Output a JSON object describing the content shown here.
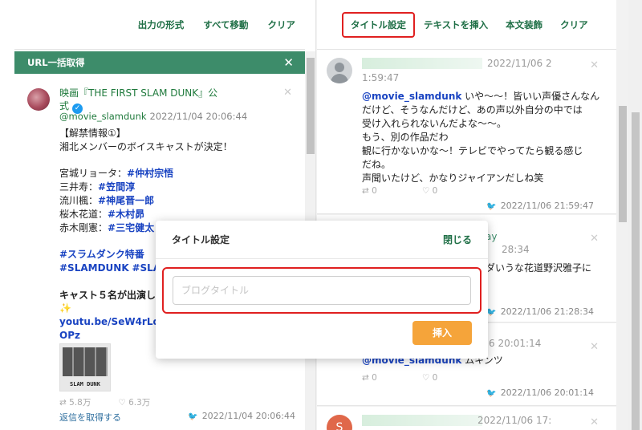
{
  "left_toolbar": {
    "buttons": [
      "出力の形式",
      "すべて移動",
      "クリア"
    ]
  },
  "right_toolbar": {
    "buttons": [
      "タイトル設定",
      "テキストを挿入",
      "本文装飾",
      "クリア"
    ]
  },
  "url_panel": {
    "title": "URL一括取得",
    "close": "✕"
  },
  "main_tweet": {
    "name_line1": "映画『THE FIRST SLAM DUNK』公",
    "name_line2": "式",
    "handle": "@movie_slamdunk",
    "timestamp": "2022/11/04 20:06:44",
    "lines": [
      {
        "parts": [
          {
            "t": "【解禁情報①】",
            "k": ""
          }
        ]
      },
      {
        "parts": [
          {
            "t": "湘北メンバーのボイスキャストが決定！",
            "k": ""
          }
        ]
      },
      {
        "parts": []
      },
      {
        "parts": [
          {
            "t": "宮城リョータ：",
            "k": ""
          },
          {
            "t": "#仲村宗悟",
            "k": "link"
          }
        ]
      },
      {
        "parts": [
          {
            "t": "三井寿：",
            "k": ""
          },
          {
            "t": "#笠間淳",
            "k": "link"
          }
        ]
      },
      {
        "parts": [
          {
            "t": "流川楓：",
            "k": ""
          },
          {
            "t": "#神尾晋一郎",
            "k": "link"
          }
        ]
      },
      {
        "parts": [
          {
            "t": "桜木花道：",
            "k": ""
          },
          {
            "t": "#木村昴",
            "k": "link"
          }
        ]
      },
      {
        "parts": [
          {
            "t": "赤木剛憲：",
            "k": ""
          },
          {
            "t": "#三宅健太",
            "k": "link"
          }
        ]
      },
      {
        "parts": []
      },
      {
        "parts": [
          {
            "t": "#スラムダンク特番",
            "k": "link"
          }
        ]
      },
      {
        "parts": [
          {
            "t": "#SLAMDUNK",
            "k": "link"
          },
          {
            "t": " ",
            "k": ""
          },
          {
            "t": "#SLAM",
            "k": "link"
          }
        ]
      },
      {
        "parts": []
      },
      {
        "parts": [
          {
            "t": "キャスト５名が出演し",
            "k": "bold"
          }
        ]
      },
      {
        "parts": [
          {
            "t": "✨",
            "k": ""
          }
        ]
      },
      {
        "parts": [
          {
            "t": "youtu.be/SeW4rLqyX",
            "k": "link"
          }
        ]
      },
      {
        "parts": [
          {
            "t": "OPz",
            "k": "link"
          }
        ]
      }
    ],
    "thumbnail_title": "SLAM DUNK",
    "retweets": "5.8万",
    "likes": "6.3万",
    "fetch_replies": "返信を取得する",
    "footer_time": "2022/11/04 20:06:44"
  },
  "timeline": {
    "card1": {
      "ts_a": "2022/11/06 2",
      "ts_b": "1:59:47",
      "lines": [
        {
          "parts": [
            {
              "t": "@movie_slamdunk",
              "k": "mention"
            },
            {
              "t": " いや〜〜！皆いい声優さんなん",
              "k": ""
            }
          ]
        },
        {
          "parts": [
            {
              "t": "だけど、そうなんだけど、あの声以外自分の中では",
              "k": ""
            }
          ]
        },
        {
          "parts": [
            {
              "t": "受け入れられないんだよな〜〜。",
              "k": ""
            }
          ]
        },
        {
          "parts": [
            {
              "t": "もう、別の作品だわ",
              "k": ""
            }
          ]
        },
        {
          "parts": [
            {
              "t": "観に行かないかな〜！テレビでやってたら観る感じ",
              "k": ""
            }
          ]
        },
        {
          "parts": [
            {
              "t": "だね。",
              "k": ""
            }
          ]
        },
        {
          "parts": [
            {
              "t": "声聞いたけど、かなりジャイアンだしね笑",
              "k": ""
            }
          ]
        }
      ],
      "retweets": "0",
      "likes": "0",
      "footer_time": "2022/11/06 21:59:47"
    },
    "card2": {
      "ts_a": "ay",
      "ts_b": "28:34",
      "lines": [
        {
          "parts": [
            {
              "t": "ダいうな花道野沢雅子に",
              "k": ""
            }
          ]
        }
      ],
      "footer_time": "2022/11/06 21:28:34"
    },
    "card3": {
      "ts_b": "6 20:01:14",
      "lines": [
        {
          "parts": [
            {
              "t": "@movie_slamdunk",
              "k": "mention"
            },
            {
              "t": " ムキンツ",
              "k": ""
            }
          ]
        }
      ],
      "retweets": "0",
      "likes": "0",
      "footer_time": "2022/11/06 20:01:14"
    },
    "card4": {
      "avatar_letter": "S",
      "ts_a": "2022/11/06 17:"
    }
  },
  "modal": {
    "title": "タイトル設定",
    "close_label": "閉じる",
    "input_placeholder": "ブログタイトル",
    "input_value": "",
    "insert_label": "挿入"
  },
  "colors": {
    "accent_green": "#3d8c6a",
    "link_blue": "#1a44c2",
    "insert_orange": "#f5a43a",
    "highlight_red": "#e02020"
  }
}
